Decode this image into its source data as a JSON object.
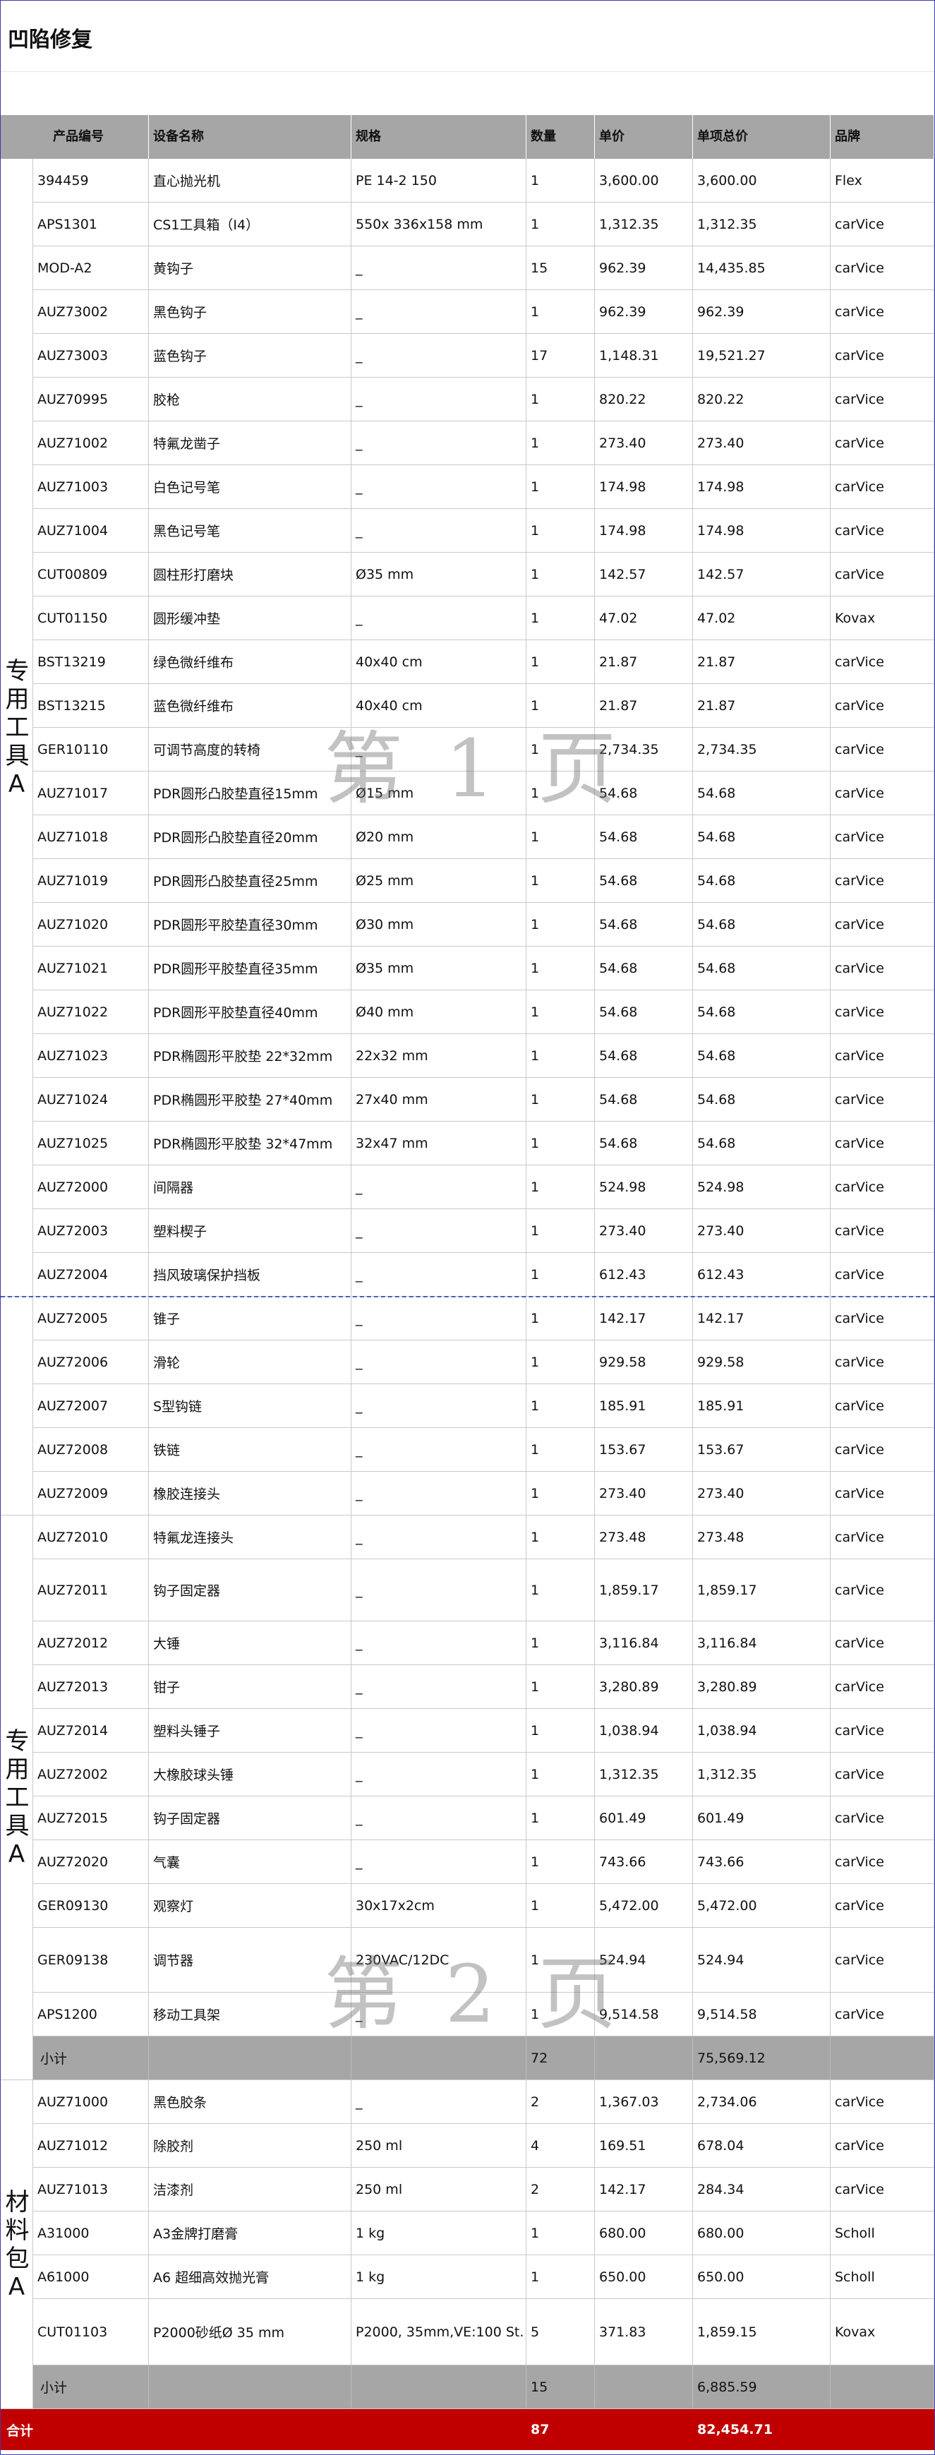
{
  "title": "凹陷修复",
  "columns": [
    "产品编号",
    "设备名称",
    "规格",
    "数量",
    "单价",
    "单项总价",
    "品牌"
  ],
  "groups": [
    {
      "label": "专用工具A",
      "rows": [
        [
          "394459",
          "直心抛光机",
          "PE 14-2 150",
          "1",
          "3,600.00",
          "3,600.00",
          "Flex"
        ],
        [
          "APS1301",
          "CS1工具箱（I4）",
          " 550x 336x158 mm",
          "1",
          "1,312.35",
          "1,312.35",
          "carVice"
        ],
        [
          "MOD-A2",
          "黄钩子",
          "_",
          "15",
          "962.39",
          "14,435.85",
          "carVice"
        ],
        [
          "AUZ73002",
          "黑色钩子",
          "_",
          "1",
          "962.39",
          "962.39",
          "carVice"
        ],
        [
          "AUZ73003",
          "蓝色钩子",
          "_",
          "17",
          "1,148.31",
          "19,521.27",
          "carVice"
        ],
        [
          "AUZ70995",
          "胶枪",
          "_",
          "1",
          "820.22",
          "820.22",
          "carVice"
        ],
        [
          "AUZ71002",
          "特氟龙凿子",
          "_",
          "1",
          "273.40",
          "273.40",
          "carVice"
        ],
        [
          "AUZ71003",
          "白色记号笔",
          "_",
          "1",
          "174.98",
          "174.98",
          "carVice"
        ],
        [
          "AUZ71004",
          "黑色记号笔",
          "_",
          "1",
          "174.98",
          "174.98",
          "carVice"
        ],
        [
          "CUT00809",
          "圆柱形打磨块",
          "Ø35 mm",
          "1",
          "142.57",
          "142.57",
          "carVice"
        ],
        [
          "CUT01150",
          "圆形缓冲垫",
          "_",
          "1",
          "47.02",
          "47.02",
          "Kovax"
        ],
        [
          "BST13219",
          "绿色微纤维布",
          "40x40 cm",
          "1",
          "21.87",
          "21.87",
          "carVice"
        ],
        [
          "BST13215",
          "蓝色微纤维布",
          "40x40 cm",
          "1",
          "21.87",
          "21.87",
          "carVice"
        ],
        [
          "GER10110",
          "可调节高度的转椅",
          "_",
          "1",
          "2,734.35",
          "2,734.35",
          "carVice"
        ],
        [
          "AUZ71017",
          " PDR圆形凸胶垫直径15mm",
          "Ø15 mm",
          "1",
          "54.68",
          "54.68",
          "carVice"
        ],
        [
          "AUZ71018",
          "PDR圆形凸胶垫直径20mm",
          "Ø20 mm",
          "1",
          "54.68",
          "54.68",
          "carVice"
        ],
        [
          "AUZ71019",
          "PDR圆形凸胶垫直径25mm",
          "Ø25 mm",
          "1",
          "54.68",
          "54.68",
          "carVice"
        ],
        [
          "AUZ71020",
          "PDR圆形平胶垫直径30mm",
          "Ø30 mm",
          "1",
          "54.68",
          "54.68",
          "carVice"
        ],
        [
          "AUZ71021",
          "PDR圆形平胶垫直径35mm",
          " Ø35 mm",
          "1",
          "54.68",
          "54.68",
          "carVice"
        ],
        [
          "AUZ71022",
          "PDR圆形平胶垫直径40mm",
          "Ø40 mm",
          "1",
          "54.68",
          "54.68",
          "carVice"
        ],
        [
          "AUZ71023",
          "PDR椭圆形平胶垫 22*32mm",
          " 22x32 mm",
          "1",
          "54.68",
          "54.68",
          "carVice"
        ],
        [
          "AUZ71024",
          "PDR椭圆形平胶垫 27*40mm",
          "27x40 mm",
          "1",
          "54.68",
          "54.68",
          "carVice"
        ],
        [
          "AUZ71025",
          "PDR椭圆形平胶垫 32*47mm",
          "32x47 mm",
          "1",
          "54.68",
          "54.68",
          "carVice"
        ],
        [
          "AUZ72000",
          "间隔器",
          "_",
          "1",
          "524.98",
          "524.98",
          "carVice"
        ],
        [
          "AUZ72003",
          "塑料楔子",
          "_",
          "1",
          "273.40",
          "273.40",
          "carVice"
        ],
        [
          "AUZ72004",
          "挡风玻璃保护挡板",
          "_",
          "1",
          "612.43",
          "612.43",
          "carVice"
        ]
      ]
    },
    {
      "label": "",
      "rows": [
        [
          "AUZ72005",
          "锥子",
          "_",
          "1",
          "142.17",
          "142.17",
          "carVice"
        ],
        [
          "AUZ72006",
          "滑轮",
          "_",
          "1",
          "929.58",
          "929.58",
          "carVice"
        ],
        [
          "AUZ72007",
          "S型钩链",
          "_",
          "1",
          "185.91",
          "185.91",
          "carVice"
        ],
        [
          "AUZ72008",
          "铁链",
          "_",
          "1",
          "153.67",
          "153.67",
          "carVice"
        ],
        [
          "AUZ72009",
          "橡胶连接头",
          "_",
          "1",
          "273.40",
          "273.40",
          "carVice"
        ]
      ]
    },
    {
      "label": "专用工具A",
      "rows": [
        [
          "AUZ72010",
          "特氟龙连接头",
          "_",
          "1",
          "273.48",
          "273.48",
          "carVice"
        ],
        [
          "AUZ72011",
          "钩子固定器",
          "_",
          "1",
          "1,859.17",
          "1,859.17",
          "carVice"
        ],
        [
          "AUZ72012",
          "大锤",
          "_",
          "1",
          "3,116.84",
          "3,116.84",
          "carVice"
        ],
        [
          "AUZ72013",
          "钳子",
          "_",
          "1",
          "3,280.89",
          "3,280.89",
          "carVice"
        ],
        [
          "AUZ72014",
          "塑料头锤子",
          "_",
          "1",
          "1,038.94",
          "1,038.94",
          "carVice"
        ],
        [
          "AUZ72002",
          "大橡胶球头锤",
          "_",
          "1",
          "1,312.35",
          "1,312.35",
          "carVice"
        ],
        [
          "AUZ72015",
          "钩子固定器",
          "_",
          "1",
          "601.49",
          "601.49",
          "carVice"
        ],
        [
          "AUZ72020",
          "气囊",
          "_",
          "1",
          "743.66",
          "743.66",
          "carVice"
        ],
        [
          "GER09130",
          "观察灯",
          "30x17x2cm",
          "1",
          "5,472.00",
          "5,472.00",
          "carVice"
        ],
        [
          "GER09138",
          "调节器",
          "230VAC/12DC",
          "1",
          "524.94",
          "524.94",
          "carVice"
        ],
        [
          "APS1200",
          "移动工具架",
          "_",
          "1",
          "9,514.58",
          "9,514.58",
          "carVice"
        ]
      ],
      "subtotal": [
        "小计",
        "72",
        "75,569.12"
      ]
    },
    {
      "label": "材料包A",
      "rows": [
        [
          "AUZ71000",
          "黑色胶条",
          "_",
          "2",
          "1,367.03",
          "2,734.06",
          "carVice"
        ],
        [
          "AUZ71012",
          "除胶剂",
          "250 ml",
          "4",
          "169.51",
          "678.04",
          "carVice"
        ],
        [
          "AUZ71013",
          "洁漆剂",
          "250 ml",
          "2",
          "142.17",
          "284.34",
          "carVice"
        ],
        [
          "A31000",
          "A3金牌打磨膏",
          "1 kg",
          "1",
          "680.00",
          "680.00",
          "Scholl"
        ],
        [
          "A61000",
          "A6 超细高效抛光膏",
          "1 kg",
          "1",
          "650.00",
          "650.00",
          "Scholl"
        ],
        [
          "CUT01103",
          "P2000砂纸Ø 35 mm",
          "P2000, 35mm,VE:100 St.",
          "5",
          "371.83",
          "1,859.15",
          "Kovax"
        ]
      ],
      "subtotal": [
        "小计",
        "15",
        "6,885.59"
      ]
    }
  ],
  "total": [
    "合计",
    "87",
    "82,454.71"
  ],
  "watermarks": [
    "第 1 页",
    "第 2 页"
  ]
}
